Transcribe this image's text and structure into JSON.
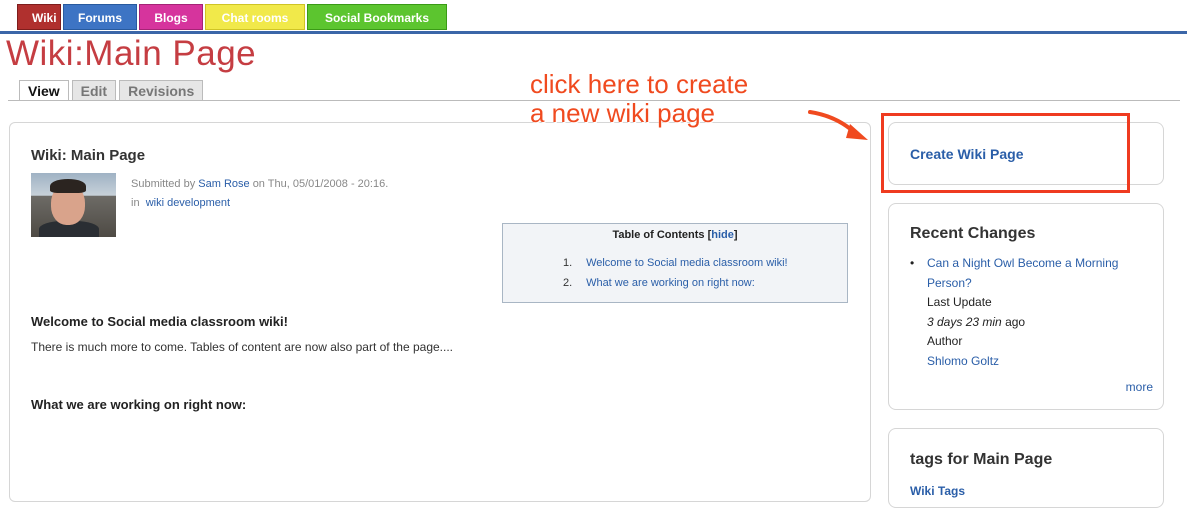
{
  "nav": {
    "tabs": [
      {
        "label": "Wiki"
      },
      {
        "label": "Forums"
      },
      {
        "label": "Blogs"
      },
      {
        "label": "Chat rooms"
      },
      {
        "label": "Social Bookmarks"
      }
    ]
  },
  "page": {
    "title": "Wiki:Main Page",
    "tabs": [
      {
        "label": "View",
        "active": true
      },
      {
        "label": "Edit"
      },
      {
        "label": "Revisions"
      }
    ]
  },
  "node": {
    "title": "Wiki: Main Page",
    "submitted_prefix": "Submitted by",
    "author": "Sam Rose",
    "submitted_suffix": "on Thu, 05/01/2008 - 20:16.",
    "in_prefix": "in",
    "category": "wiki development",
    "toc": {
      "title": "Table of Contents",
      "bracket_open": "[",
      "hide_label": "hide",
      "bracket_close": "]",
      "items": [
        {
          "num": "1.",
          "label": "Welcome to Social media classroom wiki!"
        },
        {
          "num": "2.",
          "label": "What we are working on right now:"
        }
      ]
    },
    "section1_heading": "Welcome to Social media classroom wiki!",
    "section1_text": "There is much more to come. Tables of content are now also part of the page....",
    "section2_heading": "What we are working on right now:"
  },
  "annotation": {
    "text": "click here to create\na new wiki page",
    "color": "#f04a1f"
  },
  "sidebar": {
    "create_link": "Create Wiki Page",
    "recent": {
      "title": "Recent Changes",
      "item_title": "Can a Night Owl Become a Morning Person?",
      "last_update_label": "Last Update",
      "last_update_value": "3 days 23 min",
      "last_update_suffix": "ago",
      "author_label": "Author",
      "author": "Shlomo Goltz",
      "more": "more"
    },
    "tags": {
      "title": "tags for Main Page",
      "link": "Wiki Tags"
    }
  },
  "colors": {
    "title_red": "#c53d42",
    "link_blue": "#2a5ea8",
    "highlight_red": "#ef3b20",
    "nav_rule": "#3b66a8"
  }
}
